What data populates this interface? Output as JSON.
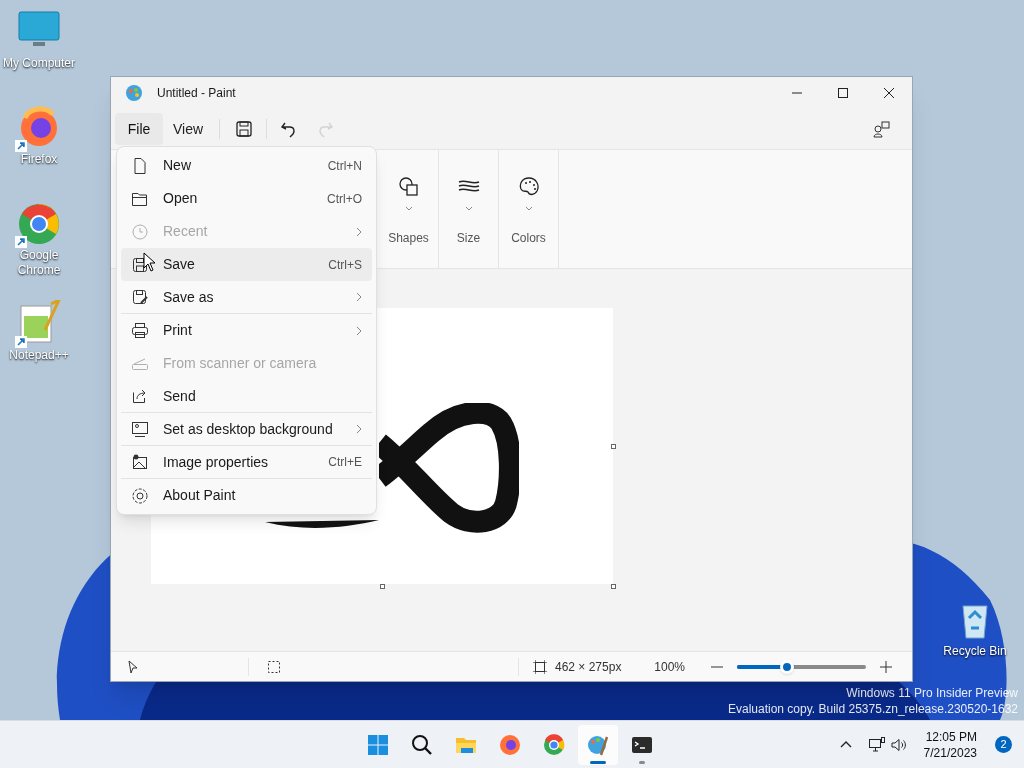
{
  "desktop_icons": [
    {
      "kind": "computer",
      "label": "My Computer",
      "shortcut": false
    },
    {
      "kind": "firefox",
      "label": "Firefox",
      "shortcut": true
    },
    {
      "kind": "chrome",
      "label": "Google Chrome",
      "shortcut": true
    },
    {
      "kind": "notepad",
      "label": "Notepad++",
      "shortcut": true
    },
    {
      "kind": "recycle",
      "label": "Recycle Bin",
      "shortcut": false
    }
  ],
  "window": {
    "title": "Untitled - Paint"
  },
  "menu_bar": [
    {
      "label": "File",
      "selected": true
    },
    {
      "label": "View",
      "selected": false
    }
  ],
  "quick_actions": [
    {
      "kind": "save",
      "disabled": false
    },
    {
      "kind": "undo",
      "disabled": false
    },
    {
      "kind": "redo",
      "disabled": true
    }
  ],
  "ribbon_groups": [
    {
      "kind": "shapes",
      "label": "Shapes"
    },
    {
      "kind": "size",
      "label": "Size"
    },
    {
      "kind": "colors",
      "label": "Colors"
    }
  ],
  "file_menu": [
    {
      "kind": "new",
      "label": "New",
      "shortcut": "Ctrl+N",
      "submenu": false,
      "disabled": false,
      "highlighted": false,
      "separator_after": false
    },
    {
      "kind": "open",
      "label": "Open",
      "shortcut": "Ctrl+O",
      "submenu": false,
      "disabled": false,
      "highlighted": false,
      "separator_after": false
    },
    {
      "kind": "recent",
      "label": "Recent",
      "submenu": true,
      "disabled": true,
      "highlighted": false,
      "separator_after": false
    },
    {
      "kind": "save",
      "label": "Save",
      "shortcut": "Ctrl+S",
      "submenu": false,
      "disabled": false,
      "highlighted": true,
      "separator_after": false
    },
    {
      "kind": "save_as",
      "label": "Save as",
      "submenu": true,
      "disabled": false,
      "highlighted": false,
      "separator_after": true
    },
    {
      "kind": "print",
      "label": "Print",
      "submenu": true,
      "disabled": false,
      "highlighted": false,
      "separator_after": false
    },
    {
      "kind": "scanner",
      "label": "From scanner or camera",
      "submenu": false,
      "disabled": true,
      "highlighted": false,
      "separator_after": false
    },
    {
      "kind": "send",
      "label": "Send",
      "submenu": false,
      "disabled": false,
      "highlighted": false,
      "separator_after": true
    },
    {
      "kind": "background",
      "label": "Set as desktop background",
      "submenu": true,
      "disabled": false,
      "highlighted": false,
      "separator_after": true
    },
    {
      "kind": "properties",
      "label": "Image properties",
      "shortcut": "Ctrl+E",
      "submenu": false,
      "disabled": false,
      "highlighted": false,
      "separator_after": true
    },
    {
      "kind": "about",
      "label": "About Paint",
      "submenu": false,
      "disabled": false,
      "highlighted": false,
      "separator_after": false
    }
  ],
  "status_bar": {
    "dimensions": "462 × 275px",
    "zoom": "100%",
    "zoom_slider": {
      "level": 0.39
    }
  },
  "os_notice": [
    "Windows 11 Pro Insider Preview",
    "Evaluation copy. Build 25375.zn_release.230520-1632"
  ],
  "taskbar": {
    "apps": [
      {
        "kind": "start",
        "running": false,
        "selected": false
      },
      {
        "kind": "search",
        "running": false,
        "selected": false
      },
      {
        "kind": "explorer",
        "running": false,
        "selected": false
      },
      {
        "kind": "firefox",
        "running": false,
        "selected": false
      },
      {
        "kind": "chrome",
        "running": false,
        "selected": false
      },
      {
        "kind": "paint",
        "running": true,
        "selected": true
      },
      {
        "kind": "terminal",
        "running": true,
        "selected": false
      }
    ],
    "time": "12:05 PM",
    "date": "7/21/2023",
    "notification_count": "2"
  }
}
